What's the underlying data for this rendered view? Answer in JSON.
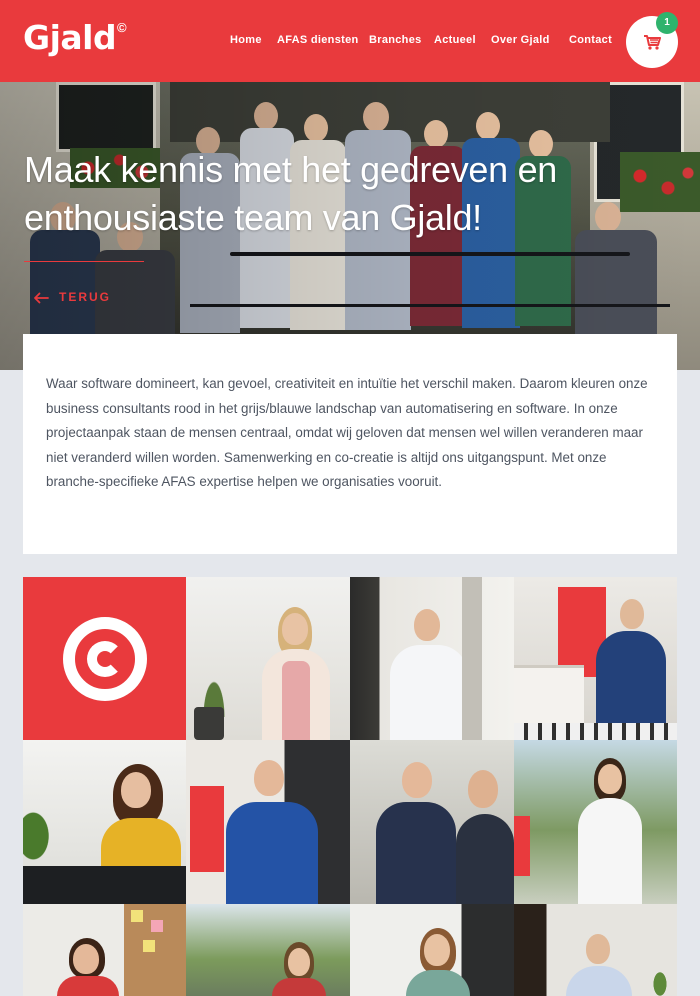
{
  "header": {
    "logo_text": "Gjald",
    "logo_mark": "©",
    "nav": [
      "Home",
      "AFAS diensten",
      "Branches",
      "Actueel",
      "Over Gjald",
      "Contact"
    ],
    "cart_count": "1"
  },
  "hero": {
    "title": "Maak kennis met het gedreven en enthousiaste team van Gjald!",
    "back_label": "TERUG"
  },
  "intro": {
    "text": "Waar software domineert, kan gevoel, creativiteit en intuïtie het verschil maken. Daarom kleuren onze business consultants rood in het grijs/blauwe landschap van automatisering en software. In onze projectaanpak staan de mensen centraal, omdat wij geloven dat mensen wel willen veranderen maar niet veranderd willen worden.  Samenwerking en co-creatie is altijd ons uitgangspunt. Met onze branche-specifieke AFAS expertise helpen we organisaties vooruit."
  },
  "team_grid": {
    "tiles": [
      "logo-tile",
      "photo",
      "photo",
      "photo",
      "photo",
      "photo",
      "photo",
      "photo",
      "photo",
      "photo",
      "photo",
      "photo"
    ]
  },
  "colors": {
    "brand_red": "#e93a3d",
    "badge_green": "#2fb36d",
    "page_bg": "#e4e7ec"
  },
  "icons": [
    "cart-icon",
    "arrow-left-icon",
    "copyright-icon"
  ]
}
